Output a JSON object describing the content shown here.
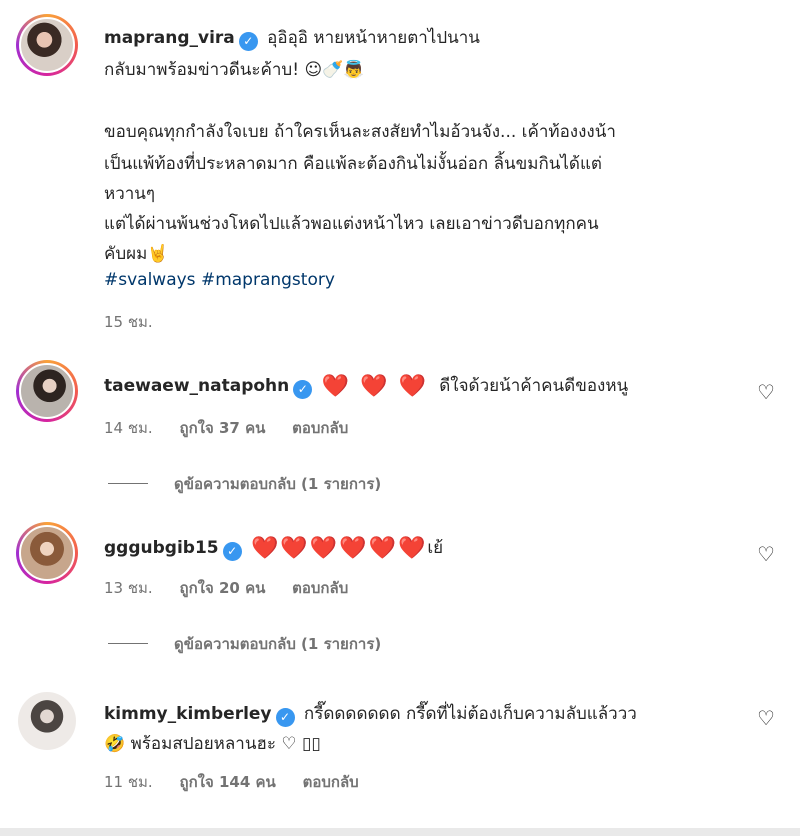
{
  "caption": {
    "username": "maprang_vira",
    "line1": "อุอิอุอิ หายหน้าหายตาไปนาน",
    "line2": "กลับมาพร้อมข่าวดีนะค้าบ! ☺🍼👼",
    "line3": "ขอบคุณทุกกำลังใจเบย ถ้าใครเห็นละสงสัยทำไมอ้วนจัง... เค้าท้องงงน้า",
    "line4": "เป็นแพ้ท้องที่ประหลาดมาก คือแพ้ละต้องกินไม่งั้นอ่อก ลิ้นขมกินได้แต่",
    "line5": "หวานๆ",
    "line6": "แต่ได้ผ่านพ้นช่วงโหดไปแล้วพอแต่งหน้าไหว เลยเอาข่าวดีบอกทุกคน",
    "line7": "คับผม🤘",
    "hashtags": "#svalways #maprangstory",
    "time": "15 ชม."
  },
  "comments": [
    {
      "username": "taewaew_natapohn",
      "hearts": "❤️ ❤️ ❤️",
      "text": "ดีใจด้วยน้าค้าคนดีของหนู",
      "time": "14 ชม.",
      "likes": "ถูกใจ 37 คน",
      "reply": "ตอบกลับ",
      "view_replies": "ดูข้อความตอบกลับ (1 รายการ)"
    },
    {
      "username": "gggubgib15",
      "hearts": "❤️❤️❤️❤️❤️❤️",
      "text": "เย้",
      "time": "13 ชม.",
      "likes": "ถูกใจ 20 คน",
      "reply": "ตอบกลับ",
      "view_replies": "ดูข้อความตอบกลับ (1 รายการ)"
    },
    {
      "username": "kimmy_kimberley",
      "text": "กรี๊ดดดดดดด กรี๊ดที่ไม่ต้องเก็บความลับแล้ววว",
      "text2": "🤣 พร้อมสปอยหลานฮะ ♡ ▯▯",
      "time": "11 ชม.",
      "likes": "ถูกใจ 144 คน",
      "reply": "ตอบกลับ"
    }
  ],
  "icons": {
    "verified": "verified-badge-icon",
    "like": "heart-outline-icon",
    "like_glyph": "♡",
    "verified_glyph": "✓"
  }
}
